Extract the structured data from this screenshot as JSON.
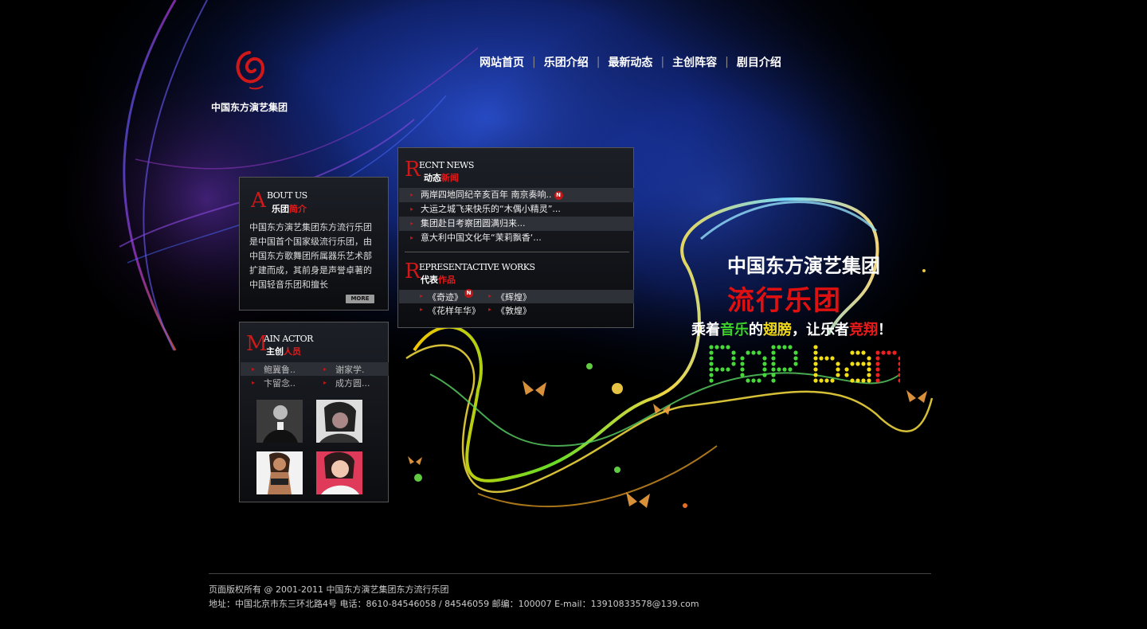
{
  "logo": {
    "name": "中国东方演艺集团",
    "icon": "swirl-logo-icon"
  },
  "nav": [
    "网站首页",
    "乐团介绍",
    "最新动态",
    "主创阵容",
    "剧目介绍"
  ],
  "nav_separator": "|",
  "about": {
    "initial": "A",
    "title_en": "BOUT US",
    "title_cn_white": "乐团",
    "title_cn_red": "简介",
    "text": "中国东方演艺集团东方流行乐团是中国首个国家级流行乐团，由中国东方歌舞团所属器乐艺术部扩建而成，其前身是声誉卓著的中国轻音乐团和擅长",
    "more": "MORE"
  },
  "actor": {
    "initial": "M",
    "title_en": "AIN ACTOR",
    "title_cn_white": "主创",
    "title_cn_red": "人员",
    "rows": [
      [
        "鲍冀鲁..",
        "谢家学."
      ],
      [
        "卞留念..",
        "成方圆..."
      ]
    ]
  },
  "news": {
    "initial": "R",
    "title_en": "ECNT NEWS",
    "title_cn_white": "动态",
    "title_cn_red": "新闻",
    "items": [
      "两岸四地同纪辛亥百年 南京奏响..",
      "大运之城飞来快乐的“木偶小精灵”...",
      "集团赴日考察团圆满归来...",
      "意大利中国文化年“茉莉飘香‘..."
    ],
    "badge": "N"
  },
  "works": {
    "initial": "R",
    "title_en": "EPRESENTACTIVE WORKS",
    "title_cn_white": "代表",
    "title_cn_red": "作品",
    "rows": [
      [
        "《奇迹》",
        "《辉煌》"
      ],
      [
        "《花样年华》",
        "《敦煌》"
      ]
    ],
    "badge": "N"
  },
  "slogan": {
    "line1": "中国东方演艺集团",
    "line2": "流行乐团",
    "line3_parts": [
      "乘着",
      "音乐",
      "的",
      "翅膀",
      "，让乐者",
      "竞翔",
      "！"
    ],
    "dot_text": "pop band"
  },
  "colors": {
    "accent_red": "#e21a1a",
    "green": "#3ccf2a",
    "yellow": "#f0d814",
    "bg": "#000000"
  },
  "footer": {
    "line1": "页面版权所有 @ 2001-2011 中国东方演艺集团东方流行乐团",
    "line2": "地址：中国北京市东三环北路4号 电话：8610-84546058 / 84546059 邮编：100007  E-mail：13910833578@139.com"
  }
}
